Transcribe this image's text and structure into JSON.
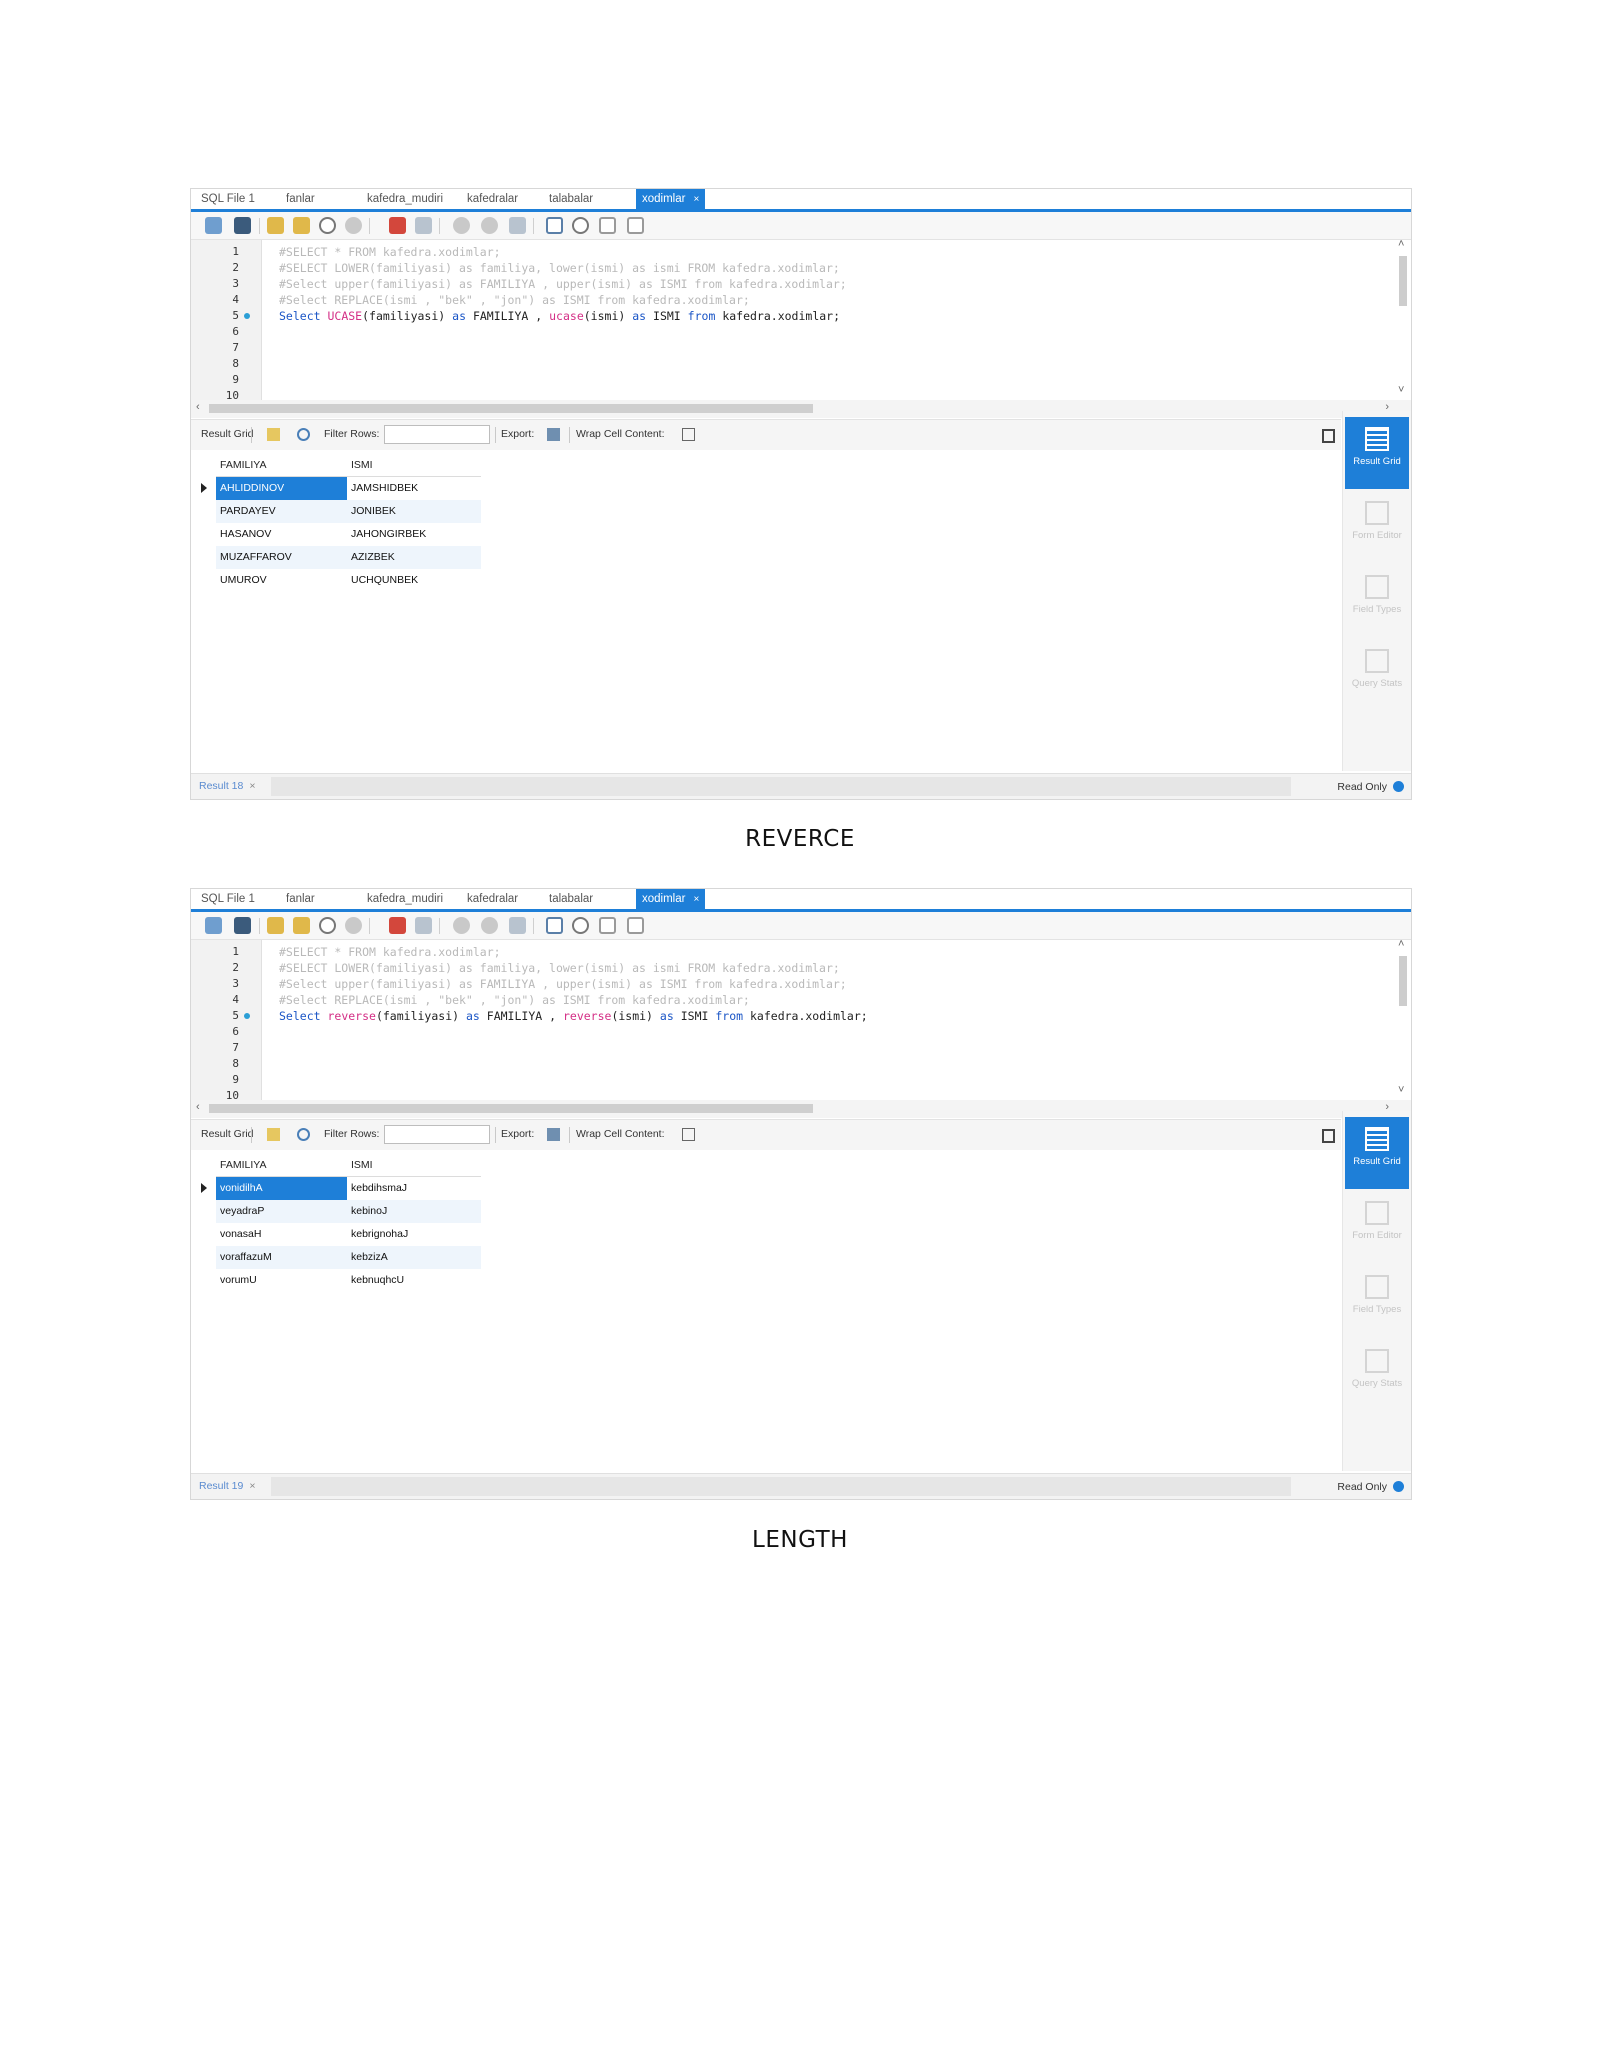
{
  "screenshots": [
    {
      "tabs": [
        "SQL File 1",
        "fanlar",
        "kafedra_mudiri",
        "kafedralar",
        "talabalar",
        "xodimlar"
      ],
      "active_tab_close": "×",
      "line_numbers": [
        "1",
        "2",
        "3",
        "4",
        "5",
        "6",
        "7",
        "8",
        "9",
        "10"
      ],
      "comment_lines": [
        "#SELECT * FROM kafedra.xodimlar;",
        "#SELECT LOWER(familiyasi) as familiya, lower(ismi) as ismi FROM kafedra.xodimlar;",
        "#Select upper(familiyasi) as FAMILIYA , upper(ismi) as ISMI from kafedra.xodimlar;",
        "#Select REPLACE(ismi , \"bek\" , \"jon\") as ISMI from kafedra.xodimlar;"
      ],
      "query": {
        "select": "Select",
        "fn1": "UCASE",
        "arg1": "(familiyasi)",
        "as1": "as",
        "alias1": "FAMILIYA ,",
        "fn2": "ucase",
        "arg2": "(ismi)",
        "as2": "as",
        "alias2": "ISMI",
        "from": "from",
        "table": "kafedra.xodimlar;"
      },
      "result_toolbar": {
        "result_grid": "Result Grid",
        "filter_rows": "Filter Rows:",
        "export": "Export:",
        "wrap": "Wrap Cell Content:"
      },
      "columns": [
        "FAMILIYA",
        "ISMI"
      ],
      "rows": [
        [
          "AHLIDDINOV",
          "JAMSHIDBEK"
        ],
        [
          "PARDAYEV",
          "JONIBEK"
        ],
        [
          "HASANOV",
          "JAHONGIRBEK"
        ],
        [
          "MUZAFFAROV",
          "AZIZBEK"
        ],
        [
          "UMUROV",
          "UCHQUNBEK"
        ]
      ],
      "sidebar": [
        "Result Grid",
        "Form Editor",
        "Field Types",
        "Query Stats"
      ],
      "result_tab": "Result 18",
      "result_tab_close": "×",
      "read_only": "Read Only"
    },
    {
      "tabs": [
        "SQL File 1",
        "fanlar",
        "kafedra_mudiri",
        "kafedralar",
        "talabalar",
        "xodimlar"
      ],
      "active_tab_close": "×",
      "line_numbers": [
        "1",
        "2",
        "3",
        "4",
        "5",
        "6",
        "7",
        "8",
        "9",
        "10"
      ],
      "comment_lines": [
        "#SELECT * FROM kafedra.xodimlar;",
        "#SELECT LOWER(familiyasi) as familiya, lower(ismi) as ismi FROM kafedra.xodimlar;",
        "#Select upper(familiyasi) as FAMILIYA , upper(ismi) as ISMI from kafedra.xodimlar;",
        "#Select REPLACE(ismi , \"bek\" , \"jon\") as ISMI from kafedra.xodimlar;"
      ],
      "query": {
        "select": "Select",
        "fn1": "reverse",
        "arg1": "(familiyasi)",
        "as1": "as",
        "alias1": "FAMILIYA ,",
        "fn2": "reverse",
        "arg2": "(ismi)",
        "as2": "as",
        "alias2": "ISMI",
        "from": "from",
        "table": "kafedra.xodimlar;"
      },
      "result_toolbar": {
        "result_grid": "Result Grid",
        "filter_rows": "Filter Rows:",
        "export": "Export:",
        "wrap": "Wrap Cell Content:"
      },
      "columns": [
        "FAMILIYA",
        "ISMI"
      ],
      "rows": [
        [
          "vonidilhA",
          "kebdihsmaJ"
        ],
        [
          "veyadraP",
          "kebinoJ"
        ],
        [
          "vonasaH",
          "kebrignohaJ"
        ],
        [
          "voraffazuM",
          "kebzizA"
        ],
        [
          "vorumU",
          "kebnuqhcU"
        ]
      ],
      "sidebar": [
        "Result Grid",
        "Form Editor",
        "Field Types",
        "Query Stats"
      ],
      "result_tab": "Result 19",
      "result_tab_close": "×",
      "read_only": "Read Only"
    }
  ],
  "captions": [
    "REVERCE",
    "LENGTH"
  ]
}
